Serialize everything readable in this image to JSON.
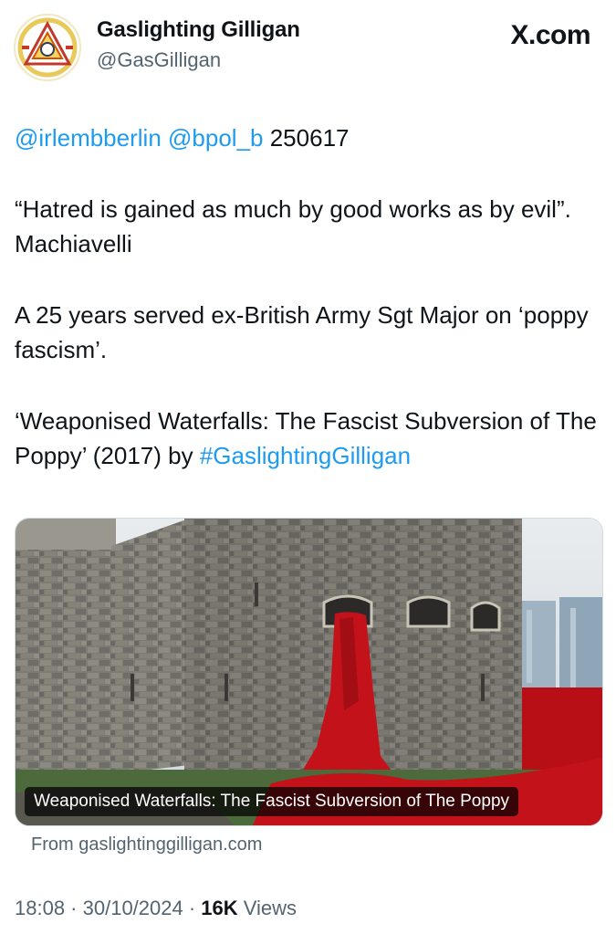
{
  "author": {
    "name": "Gaslighting Gilligan",
    "handle": "@GasGilligan"
  },
  "brand": "X.com",
  "tweet": {
    "line1": {
      "mention1": "@irlembberlin",
      "mention2": "@bpol_b",
      "code": " 250617"
    },
    "quote": "“Hatred is gained as much by good works as by evil”. Machiavelli",
    "body": "A 25 years served ex-British Army Sgt Major on ‘poppy fascism’.",
    "promo_text": "‘Weaponised Waterfalls: The Fascist Subversion of The Poppy’ (2017) by ",
    "hashtag": "#GaslightingGilligan"
  },
  "link_card": {
    "caption": "Weaponised Waterfalls: The Fascist Subversion of The Poppy",
    "source": "From gaslightinggilligan.com"
  },
  "meta": {
    "time": "18:08",
    "sep1": " · ",
    "date": "30/10/2024",
    "sep2": " · ",
    "views_count": "16K",
    "views_label": " Views"
  },
  "colors": {
    "link": "#1d9bf0",
    "secondary_text": "#536471",
    "poppy_red": "#c4121a"
  }
}
